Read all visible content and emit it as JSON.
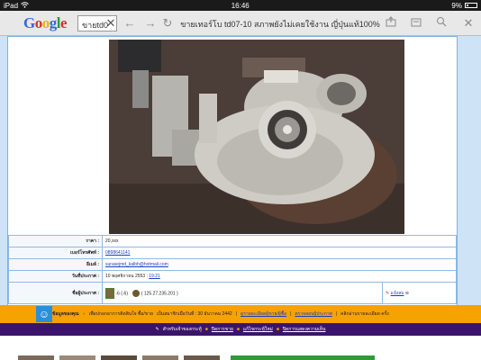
{
  "statusbar": {
    "device": "iPad",
    "time": "16:46",
    "battery": "9%"
  },
  "browser": {
    "search_text": "ขายtd0",
    "page_title": "ขายเทอร์โบ td07-10 สภาพยังไม่เคยใช้งาน ญี่ปุ่นแท้100%",
    "icons": [
      "close-icon",
      "back-icon",
      "forward-icon",
      "refresh-icon",
      "share-icon",
      "tabs-icon",
      "find-icon",
      "close-tab-icon"
    ]
  },
  "google": {
    "logo": "Google"
  },
  "listing": {
    "rows": [
      {
        "label": "ราคา :",
        "value": "20,xxx"
      },
      {
        "label": "เบอร์โทรศัพท์ :",
        "value": "0898641141"
      },
      {
        "label": "อีเมล์ :",
        "value": "surasejmd_kalbh@hotmail.com"
      },
      {
        "label": "วันที่ประกาศ :",
        "value": "10 พฤศจิกายน 2553 :",
        "value_link": "19:21"
      },
      {
        "label": "ชื่อผู้ประกาศ :",
        "poster_score": "-6 (-6)",
        "poster_ip": "( 125.27.235.201 )",
        "report": "แจ้งลบ"
      }
    ]
  },
  "orange_bar": {
    "text_1": "ข้อมูลของคุณ",
    "text_2": "เพื่อปกอกอาการติดสินใจ ซื้อ/ขาย",
    "text_3": "เป็นสมาชิกเมื่อวันที่ : 30 ธันวาคม 2442",
    "link_1": "ดูรายละเอียดผู้ขาย/ผู้ซื้อ",
    "link_2": "ตรวจสอบผู้ประกาศ",
    "text_4": "คลิกอ่านรายละเอียด ครั้ง"
  },
  "purple_bar": {
    "item_1": "สำหรับเจ้าของกระทู้",
    "item_2": "ปิดการขาย",
    "item_3": "แก้ไขกระทู้ใหม่",
    "item_4": "ปิดการแสดงความเห็น"
  },
  "colors": {
    "page_bg": "#cfe3f7",
    "orange_bar": "#f4a300",
    "purple_bar": "#3a146b",
    "link": "#1a3cc4"
  }
}
